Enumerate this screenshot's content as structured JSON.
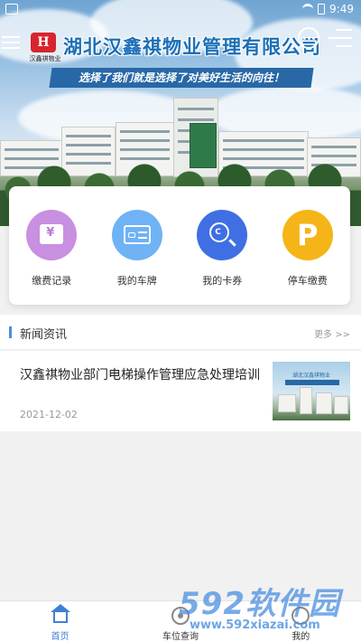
{
  "status_bar": {
    "time": "9:49"
  },
  "header": {
    "logo_text": "汉鑫祺物业",
    "company_name": "湖北汉鑫祺物业管理有限公司",
    "slogan": "选择了我们就是选择了对美好生活的向往！"
  },
  "quick_actions": [
    {
      "label": "缴费记录",
      "icon": "wallet-icon",
      "color": "#c98fe0"
    },
    {
      "label": "我的车牌",
      "icon": "license-plate-icon",
      "color": "#6fb3f5"
    },
    {
      "label": "我的卡券",
      "icon": "coupon-search-icon",
      "color": "#3f6fe2"
    },
    {
      "label": "停车缴费",
      "icon": "parking-icon",
      "color": "#f5b519"
    }
  ],
  "news": {
    "section_title": "新闻资讯",
    "more_label": "更多 >>",
    "items": [
      {
        "title": "汉鑫祺物业部门电梯操作管理应急处理培训",
        "date": "2021-12-02",
        "thumb_label": "湖北汉鑫祺物业"
      }
    ]
  },
  "tabs": [
    {
      "label": "首页",
      "icon": "home-icon",
      "active": true
    },
    {
      "label": "车位查询",
      "icon": "location-icon",
      "active": false
    },
    {
      "label": "我的",
      "icon": "user-icon",
      "active": false
    }
  ],
  "watermark": {
    "big": "592软件园",
    "small": "www.592xiazai.com"
  },
  "colors": {
    "accent": "#3f7fd8",
    "brand_blue": "#1b6fb7",
    "logo_red": "#d8242c"
  }
}
